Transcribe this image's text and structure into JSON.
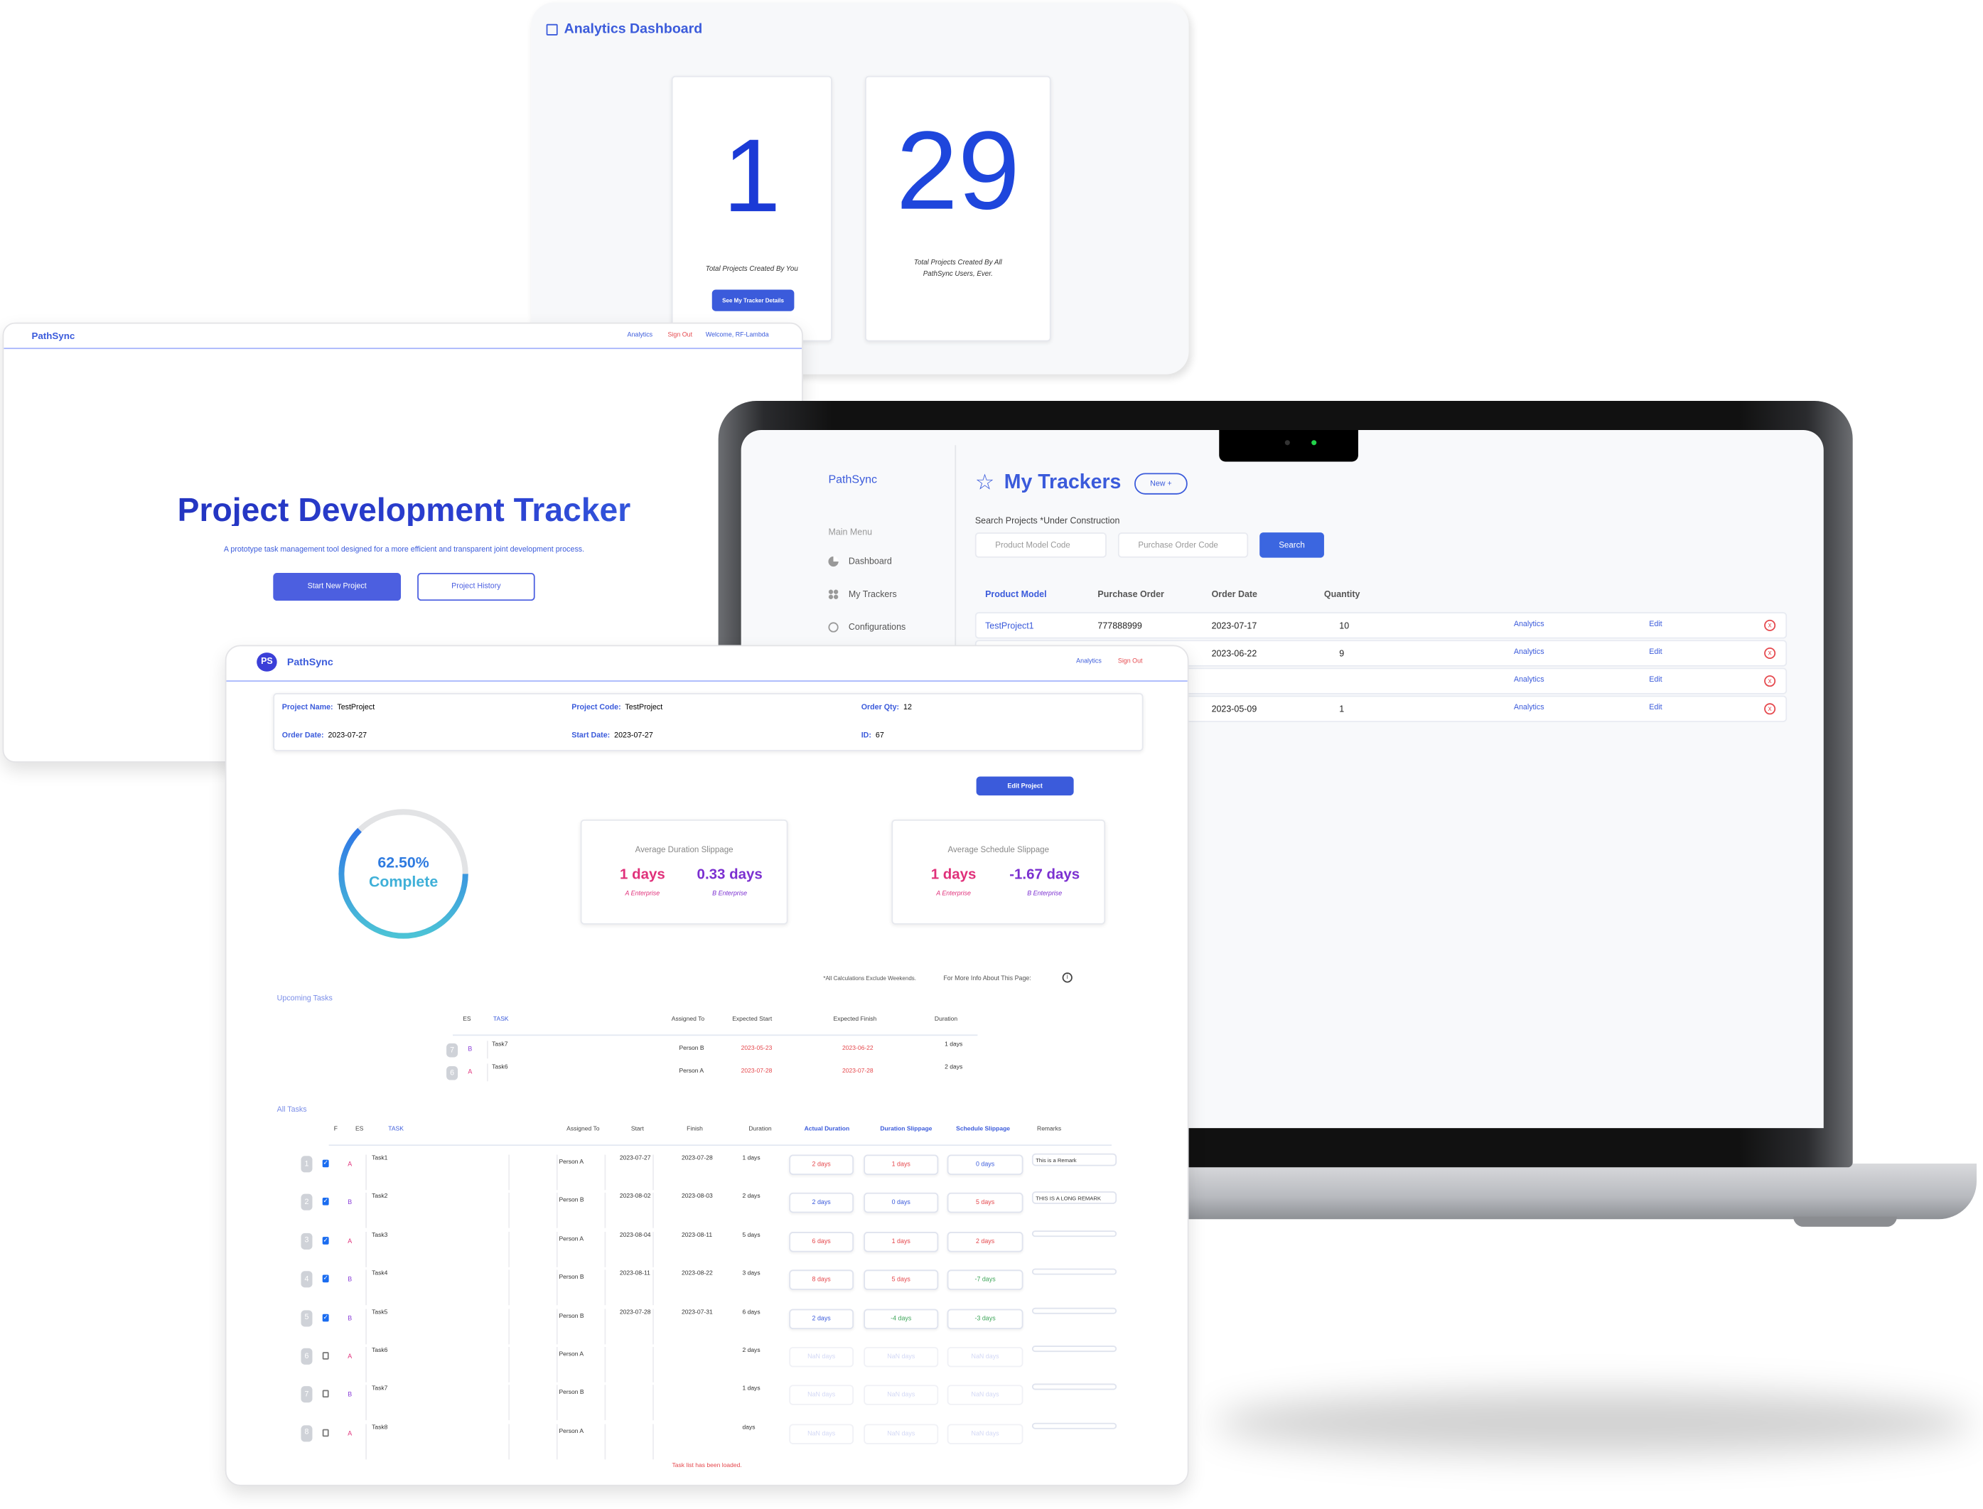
{
  "analytics": {
    "title": "Analytics Dashboard",
    "my_count": "1",
    "my_label": "Total Projects Created By You",
    "my_button": "See My Tracker Details",
    "all_count": "29",
    "all_label_1": "Total Projects Created By All",
    "all_label_2": "PathSync Users, Ever."
  },
  "landing": {
    "brand": "PathSync",
    "nav_analytics": "Analytics",
    "nav_signout": "Sign Out",
    "nav_welcome": "Welcome, RF-Lambda",
    "title": "Project Development Tracker",
    "subtitle": "A prototype task management tool designed for a more efficient and transparent joint development process.",
    "start_button": "Start New Project",
    "history_button": "Project History"
  },
  "trackers": {
    "brand": "PathSync",
    "menu_label": "Main Menu",
    "menu": [
      {
        "label": "Dashboard",
        "icon": "pie-chart-icon"
      },
      {
        "label": "My Trackers",
        "icon": "grid-icon"
      },
      {
        "label": "Configurations",
        "icon": "globe-icon"
      }
    ],
    "title": "My Trackers",
    "new_button": "New +",
    "search_label": "Search Projects *Under Construction",
    "model_placeholder": "Product Model Code",
    "po_placeholder": "Purchase Order Code",
    "search_button": "Search",
    "columns": [
      "Product Model",
      "Purchase Order",
      "Order Date",
      "Quantity"
    ],
    "rows": [
      {
        "model": "TestProject1",
        "po": "777888999",
        "date": "2023-07-17",
        "qty": "10"
      },
      {
        "model": "",
        "po": "",
        "date": "2023-06-22",
        "qty": "9"
      },
      {
        "model": "",
        "po": "",
        "date": "",
        "qty": ""
      },
      {
        "model": "",
        "po": "",
        "date": "2023-05-09",
        "qty": "1"
      }
    ],
    "analytics_link": "Analytics",
    "edit_link": "Edit",
    "delete_icon": "x"
  },
  "detail": {
    "brand": "PathSync",
    "nav_analytics": "Analytics",
    "nav_signout": "Sign Out",
    "info": {
      "name_label": "Project Name:",
      "name": "TestProject",
      "code_label": "Project Code:",
      "code": "TestProject",
      "qty_label": "Order Qty:",
      "qty": "12",
      "order_label": "Order Date:",
      "order": "2023-07-27",
      "start_label": "Start Date:",
      "start": "2023-07-27",
      "id_label": "ID:",
      "id": "67"
    },
    "edit_button": "Edit Project",
    "progress": 62.5,
    "progress_text": "62.50%",
    "progress_label": "Complete",
    "duration_card": {
      "title": "Average Duration Slippage",
      "a_value": "1 days",
      "a_label": "A Enterprise",
      "b_value": "0.33 days",
      "b_label": "B Enterprise"
    },
    "schedule_card": {
      "title": "Average Schedule Slippage",
      "a_value": "1 days",
      "a_label": "A Enterprise",
      "b_value": "-1.67 days",
      "b_label": "B Enterprise"
    },
    "note": "*All Calculations Exclude Weekends.",
    "info_text": "For More Info About This Page:",
    "upcoming_title": "Upcoming Tasks",
    "upcoming_cols": [
      "ES",
      "TASK",
      "Assigned To",
      "Expected Start",
      "Expected Finish",
      "Duration"
    ],
    "upcoming": [
      {
        "n": "7",
        "es": "B",
        "task": "Task7",
        "who": "Person B",
        "start": "2023-05-23",
        "finish": "2023-06-22",
        "dur": "1 days"
      },
      {
        "n": "6",
        "es": "A",
        "task": "Task6",
        "who": "Person A",
        "start": "2023-07-28",
        "finish": "2023-07-28",
        "dur": "2 days"
      }
    ],
    "all_title": "All Tasks",
    "all_cols": [
      "F",
      "ES",
      "TASK",
      "Assigned To",
      "Start",
      "Finish",
      "Duration",
      "Actual Duration",
      "Duration Slippage",
      "Schedule Slippage",
      "Remarks"
    ],
    "tasks": [
      {
        "n": "1",
        "f": true,
        "es": "A",
        "task": "Task1",
        "who": "Person A",
        "start": "2023-07-27",
        "finish": "2023-07-28",
        "dur": "1 days",
        "actual": "2 days",
        "actual_c": "red",
        "dslip": "1 days",
        "dslip_c": "red",
        "sslip": "0 days",
        "sslip_c": "blue",
        "remark": "This is a Remark"
      },
      {
        "n": "2",
        "f": true,
        "es": "B",
        "task": "Task2",
        "who": "Person B",
        "start": "2023-08-02",
        "finish": "2023-08-03",
        "dur": "2 days",
        "actual": "2 days",
        "actual_c": "blue",
        "dslip": "0 days",
        "dslip_c": "blue",
        "sslip": "5 days",
        "sslip_c": "red",
        "remark": "THIS IS A LONG REMARK"
      },
      {
        "n": "3",
        "f": true,
        "es": "A",
        "task": "Task3",
        "who": "Person A",
        "start": "2023-08-04",
        "finish": "2023-08-11",
        "dur": "5 days",
        "actual": "6 days",
        "actual_c": "red",
        "dslip": "1 days",
        "dslip_c": "red",
        "sslip": "2 days",
        "sslip_c": "red",
        "remark": ""
      },
      {
        "n": "4",
        "f": true,
        "es": "B",
        "task": "Task4",
        "who": "Person B",
        "start": "2023-08-11",
        "finish": "2023-08-22",
        "dur": "3 days",
        "actual": "8 days",
        "actual_c": "red",
        "dslip": "5 days",
        "dslip_c": "red",
        "sslip": "-7 days",
        "sslip_c": "green",
        "remark": ""
      },
      {
        "n": "5",
        "f": true,
        "es": "B",
        "task": "Task5",
        "who": "Person B",
        "start": "2023-07-28",
        "finish": "2023-07-31",
        "dur": "6 days",
        "actual": "2 days",
        "actual_c": "blue",
        "dslip": "-4 days",
        "dslip_c": "green",
        "sslip": "-3 days",
        "sslip_c": "green",
        "remark": ""
      },
      {
        "n": "6",
        "f": false,
        "es": "A",
        "task": "Task6",
        "who": "Person A",
        "start": "",
        "finish": "",
        "dur": "2 days",
        "actual": "NaN days",
        "actual_c": "faded",
        "dslip": "NaN days",
        "dslip_c": "faded",
        "sslip": "NaN days",
        "sslip_c": "faded",
        "remark": ""
      },
      {
        "n": "7",
        "f": false,
        "es": "B",
        "task": "Task7",
        "who": "Person B",
        "start": "",
        "finish": "",
        "dur": "1 days",
        "actual": "NaN days",
        "actual_c": "faded",
        "dslip": "NaN days",
        "dslip_c": "faded",
        "sslip": "NaN days",
        "sslip_c": "faded",
        "remark": ""
      },
      {
        "n": "8",
        "f": false,
        "es": "A",
        "task": "Task8",
        "who": "Person A",
        "start": "",
        "finish": "",
        "dur": "days",
        "actual": "NaN days",
        "actual_c": "faded",
        "dslip": "NaN days",
        "dslip_c": "faded",
        "sslip": "NaN days",
        "sslip_c": "faded",
        "remark": ""
      }
    ],
    "footer": "Task list has been loaded."
  },
  "colors": {
    "accent": "#3b5bdb",
    "danger": "#e5484d",
    "success": "#3fa65a",
    "es_a": "#e0307a",
    "es_b": "#8b3fd9"
  }
}
